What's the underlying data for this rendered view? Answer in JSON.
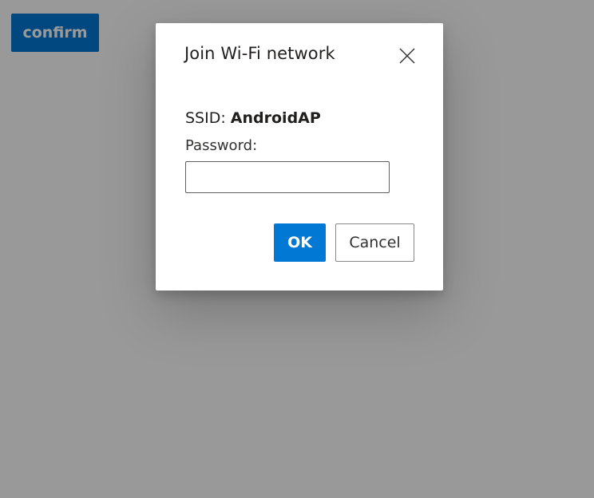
{
  "page": {
    "confirm_label": "confirm"
  },
  "dialog": {
    "title": "Join Wi-Fi network",
    "close_icon": "close-icon",
    "ssid_label": "SSID: ",
    "ssid_value": "AndroidAP",
    "password_label": "Password:",
    "password_value": "",
    "ok_label": "OK",
    "cancel_label": "Cancel"
  },
  "colors": {
    "accent": "#0078d4",
    "overlay": "rgba(0,0,0,0.4)",
    "dialog_background": "#ffffff"
  }
}
